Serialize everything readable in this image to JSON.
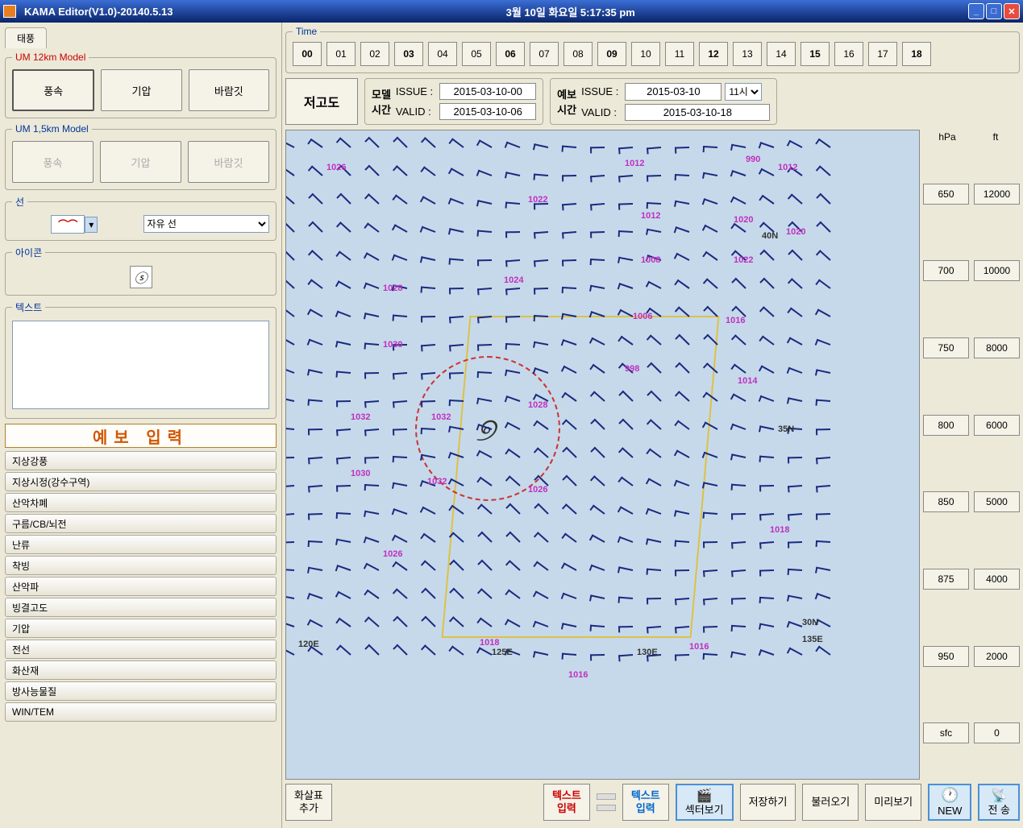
{
  "window": {
    "title": "KAMA Editor(V1.0)-20140.5.13",
    "datetime": "3월 10일  화요일  5:17:35 pm"
  },
  "sidebar": {
    "tab": "태풍",
    "model12": {
      "legend": "UM 12km Model",
      "btns": [
        "풍속",
        "기압",
        "바람깃"
      ]
    },
    "model15": {
      "legend": "UM 1,5km Model",
      "btns": [
        "풍속",
        "기압",
        "바람깃"
      ]
    },
    "line": {
      "legend": "선",
      "type": "자유 선"
    },
    "icon": {
      "legend": "아이콘",
      "sym": "ⓢ"
    },
    "text": {
      "legend": "텍스트",
      "value": ""
    },
    "forecast_input": "예보 입력",
    "items": [
      "지상강풍",
      "지상시정(강수구역)",
      "산악차폐",
      "구름/CB/뇌전",
      "난류",
      "착빙",
      "산악파",
      "빙결고도",
      "기압",
      "전선",
      "화산재",
      "방사능물질",
      "WIN/TEM"
    ]
  },
  "time": {
    "legend": "Time",
    "hours": [
      "00",
      "01",
      "02",
      "03",
      "04",
      "05",
      "06",
      "07",
      "08",
      "09",
      "10",
      "11",
      "12",
      "13",
      "14",
      "15",
      "16",
      "17",
      "18"
    ],
    "bold": [
      "00",
      "03",
      "06",
      "09",
      "12",
      "15",
      "18"
    ]
  },
  "altitude_btn": "저고도",
  "model_time": {
    "label": "모델\n시간",
    "issue_lbl": "ISSUE :",
    "issue": "2015-03-10-00",
    "valid_lbl": "VALID :",
    "valid": "2015-03-10-06"
  },
  "fcst_time": {
    "label": "예보\n시간",
    "issue_lbl": "ISSUE :",
    "issue": "2015-03-10",
    "valid_lbl": "VALID :",
    "valid": "2015-03-10-18",
    "hour": "11시"
  },
  "right": {
    "hdr": [
      "hPa",
      "ft"
    ],
    "levels": [
      [
        "650",
        "12000"
      ],
      [
        "700",
        "10000"
      ],
      [
        "750",
        "8000"
      ],
      [
        "800",
        "6000"
      ],
      [
        "850",
        "5000"
      ],
      [
        "875",
        "4000"
      ],
      [
        "950",
        "2000"
      ],
      [
        "sfc",
        "0"
      ]
    ]
  },
  "bottom": {
    "arrow_add": "화살표\n추가",
    "text_in1": "텍스트\n입력",
    "text_in2": "텍스트\n입력",
    "sector": "섹터보기",
    "save": "저장하기",
    "load": "불러오기",
    "preview": "미리보기",
    "new": "NEW",
    "send": "전 송"
  },
  "map": {
    "iso": [
      "1026",
      "1022",
      "1024",
      "1028",
      "1030",
      "1032",
      "1032",
      "1028",
      "1030",
      "1032",
      "1026",
      "1026",
      "1018",
      "1016",
      "1012",
      "1012",
      "1008",
      "1006",
      "998",
      "990",
      "1020",
      "1022",
      "1016",
      "1014",
      "1012",
      "1020",
      "1018",
      "1016"
    ],
    "lon": [
      "120E",
      "125E",
      "130E",
      "135E"
    ],
    "lat": [
      "40N",
      "35N",
      "30N"
    ]
  }
}
